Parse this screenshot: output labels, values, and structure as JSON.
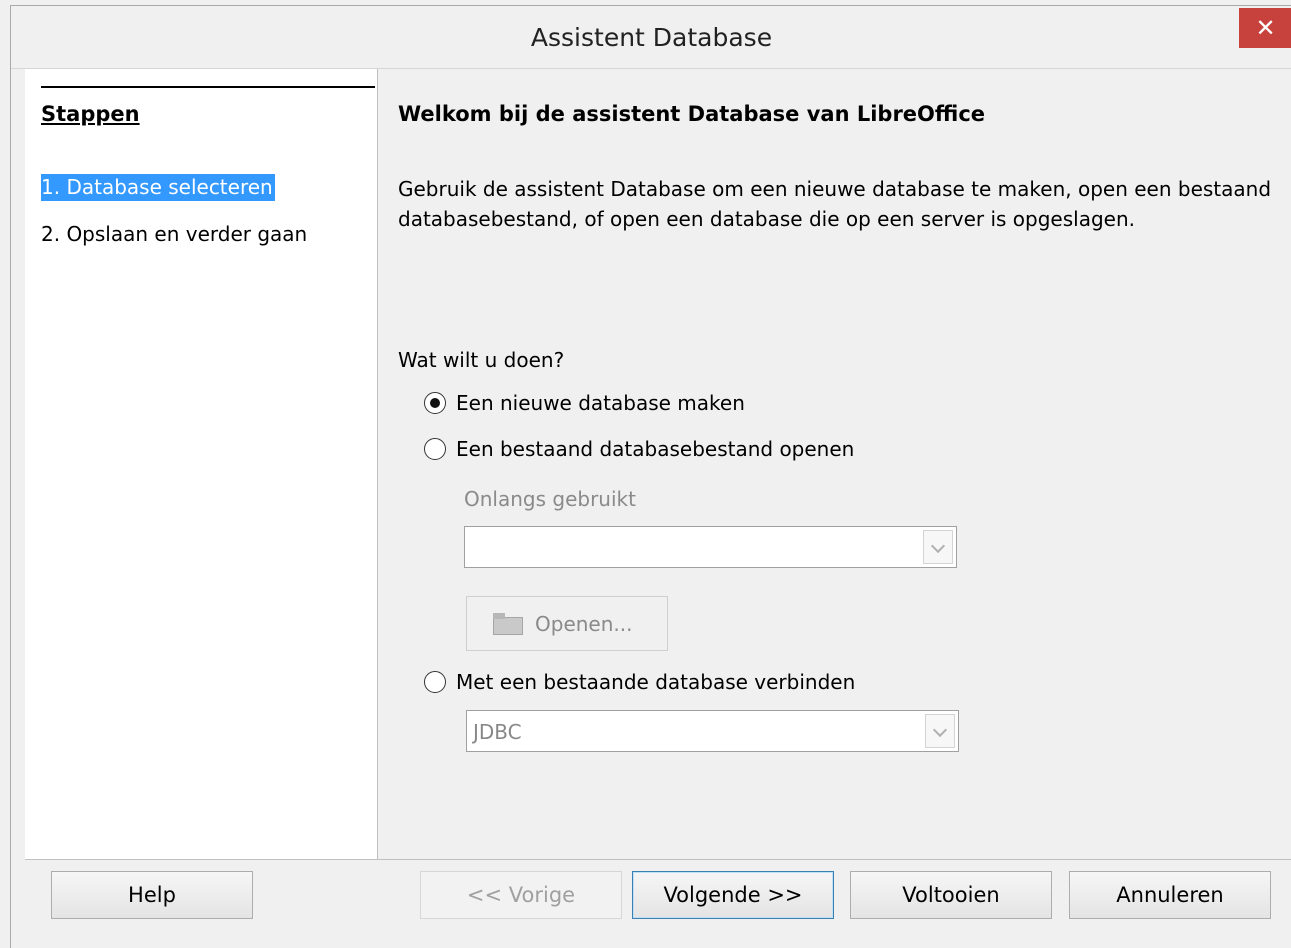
{
  "window": {
    "title": "Assistent Database",
    "close_symbol": "✕"
  },
  "sidebar": {
    "heading": "Stappen",
    "steps": [
      {
        "label": "1. Database selecteren",
        "active": true
      },
      {
        "label": "2. Opslaan en verder gaan",
        "active": false
      }
    ]
  },
  "main": {
    "heading": "Welkom bij de assistent Database van LibreOffice",
    "description": "Gebruik de assistent Database om een nieuwe database te maken, open een bestaand databasebestand, of open een database die op een server is opgeslagen.",
    "question": "Wat wilt u doen?",
    "options": [
      {
        "label": "Een nieuwe database maken",
        "checked": true
      },
      {
        "label": "Een bestaand databasebestand openen",
        "checked": false
      },
      {
        "label": "Met een bestaande database verbinden",
        "checked": false
      }
    ],
    "recent_label": "Onlangs gebruikt",
    "recent_value": "",
    "open_button": "Openen...",
    "connection_type": "JDBC"
  },
  "buttons": {
    "help": "Help",
    "previous": "<< Vorige",
    "next": "Volgende >>",
    "finish": "Voltooien",
    "cancel": "Annuleren"
  }
}
